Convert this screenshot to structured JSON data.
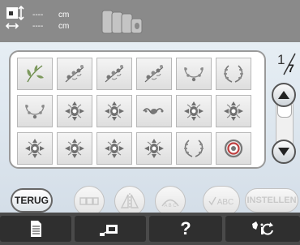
{
  "header": {
    "width_value": "----",
    "width_unit": "cm",
    "height_value": "----",
    "height_unit": "cm",
    "icons": [
      "pattern-size-icon",
      "thread-spools-icon"
    ]
  },
  "patterns": [
    {
      "icon": "leaf-sprig"
    },
    {
      "icon": "floral-spray"
    },
    {
      "icon": "floral-spray"
    },
    {
      "icon": "floral-spray"
    },
    {
      "icon": "floral-arc"
    },
    {
      "icon": "laurel-wreath"
    },
    {
      "icon": "floral-arc"
    },
    {
      "icon": "ornament"
    },
    {
      "icon": "ornament"
    },
    {
      "icon": "border-scroll"
    },
    {
      "icon": "ornament"
    },
    {
      "icon": "ornament"
    },
    {
      "icon": "ornament"
    },
    {
      "icon": "ornament"
    },
    {
      "icon": "ornament"
    },
    {
      "icon": "ornament"
    },
    {
      "icon": "laurel-wreath"
    },
    {
      "icon": "circle-frame"
    }
  ],
  "pagination": {
    "current": "1",
    "total": "7"
  },
  "buttons": {
    "back": "TERUG",
    "abc_label": "ABC",
    "abc_arc_label": "A B C",
    "set": "INSTELLEN"
  },
  "footer": {
    "icons": [
      "document-icon",
      "embroidery-frame-icon",
      "help-icon",
      "settings-icon"
    ],
    "help_label": "?"
  },
  "colors": {
    "header_bg": "#8a8a8a",
    "main_bg": "#dde6ee",
    "footer_bg": "#4a4a4a",
    "pattern_color": "#7a7a7a"
  }
}
